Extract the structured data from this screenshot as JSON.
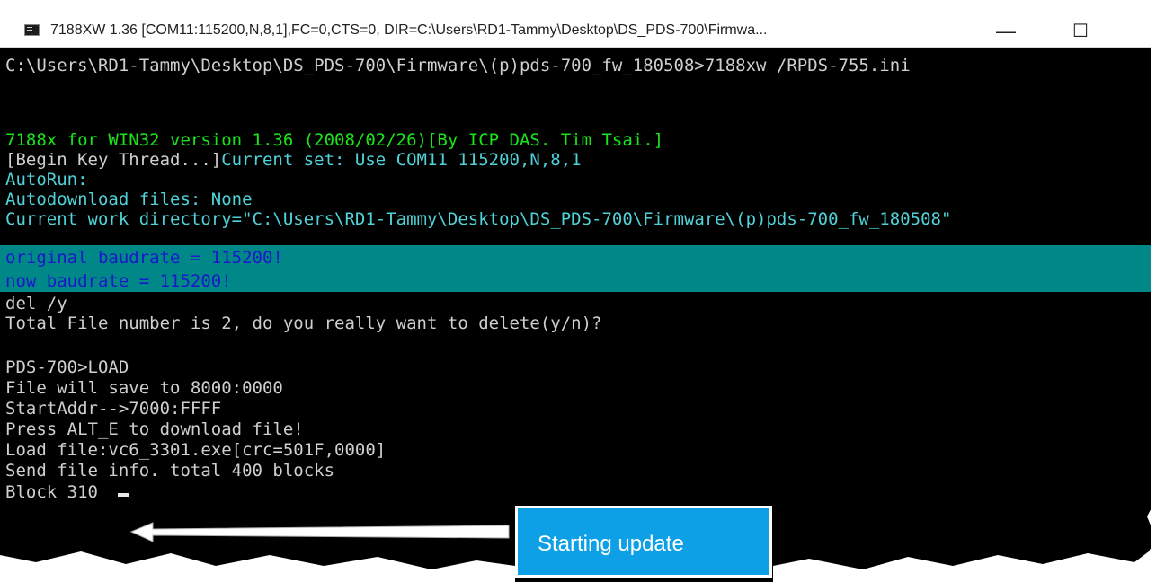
{
  "window": {
    "title": "7188XW 1.36 [COM11:115200,N,8,1],FC=0,CTS=0, DIR=C:\\Users\\RD1-Tammy\\Desktop\\DS_PDS-700\\Firmwa...",
    "minimize_glyph": "—",
    "maximize_glyph": "☐"
  },
  "console": {
    "lines": [
      "C:\\Users\\RD1-Tammy\\Desktop\\DS_PDS-700\\Firmware\\(p)pds-700_fw_180508>7188xw /RPDS-755.ini",
      "7188x for WIN32 version 1.36 (2008/02/26)[By ICP DAS. Tim Tsai.]",
      "[Begin Key Thread...]",
      "Current set: Use COM11 115200,N,8,1",
      "AutoRun:",
      "Autodownload files: None",
      "Current work directory=\"C:\\Users\\RD1-Tammy\\Desktop\\DS_PDS-700\\Firmware\\(p)pds-700_fw_180508\"",
      "original baudrate = 115200!",
      "now baudrate = 115200!",
      "del /y",
      "Total File number is 2, do you really want to delete(y/n)?",
      "PDS-700>LOAD",
      "File will save to 8000:0000",
      "StartAddr-->7000:FFFF",
      "Press ALT_E to download file!",
      "Load file:vc6_3301.exe[crc=501F,0000]",
      "Send file info. total 400 blocks",
      "Block 310"
    ]
  },
  "callout": {
    "text": "Starting update"
  },
  "colors": {
    "console_bg": "#000000",
    "text_default": "#cfcfcf",
    "text_green": "#19e619",
    "text_cyan": "#4fd2d8",
    "highlight_bar": "#008888",
    "highlight_text": "#1a18c8",
    "callout_bg": "#0da0e6"
  },
  "icons": {
    "app": "console-app-icon",
    "arrow": "left-arrow-icon"
  }
}
